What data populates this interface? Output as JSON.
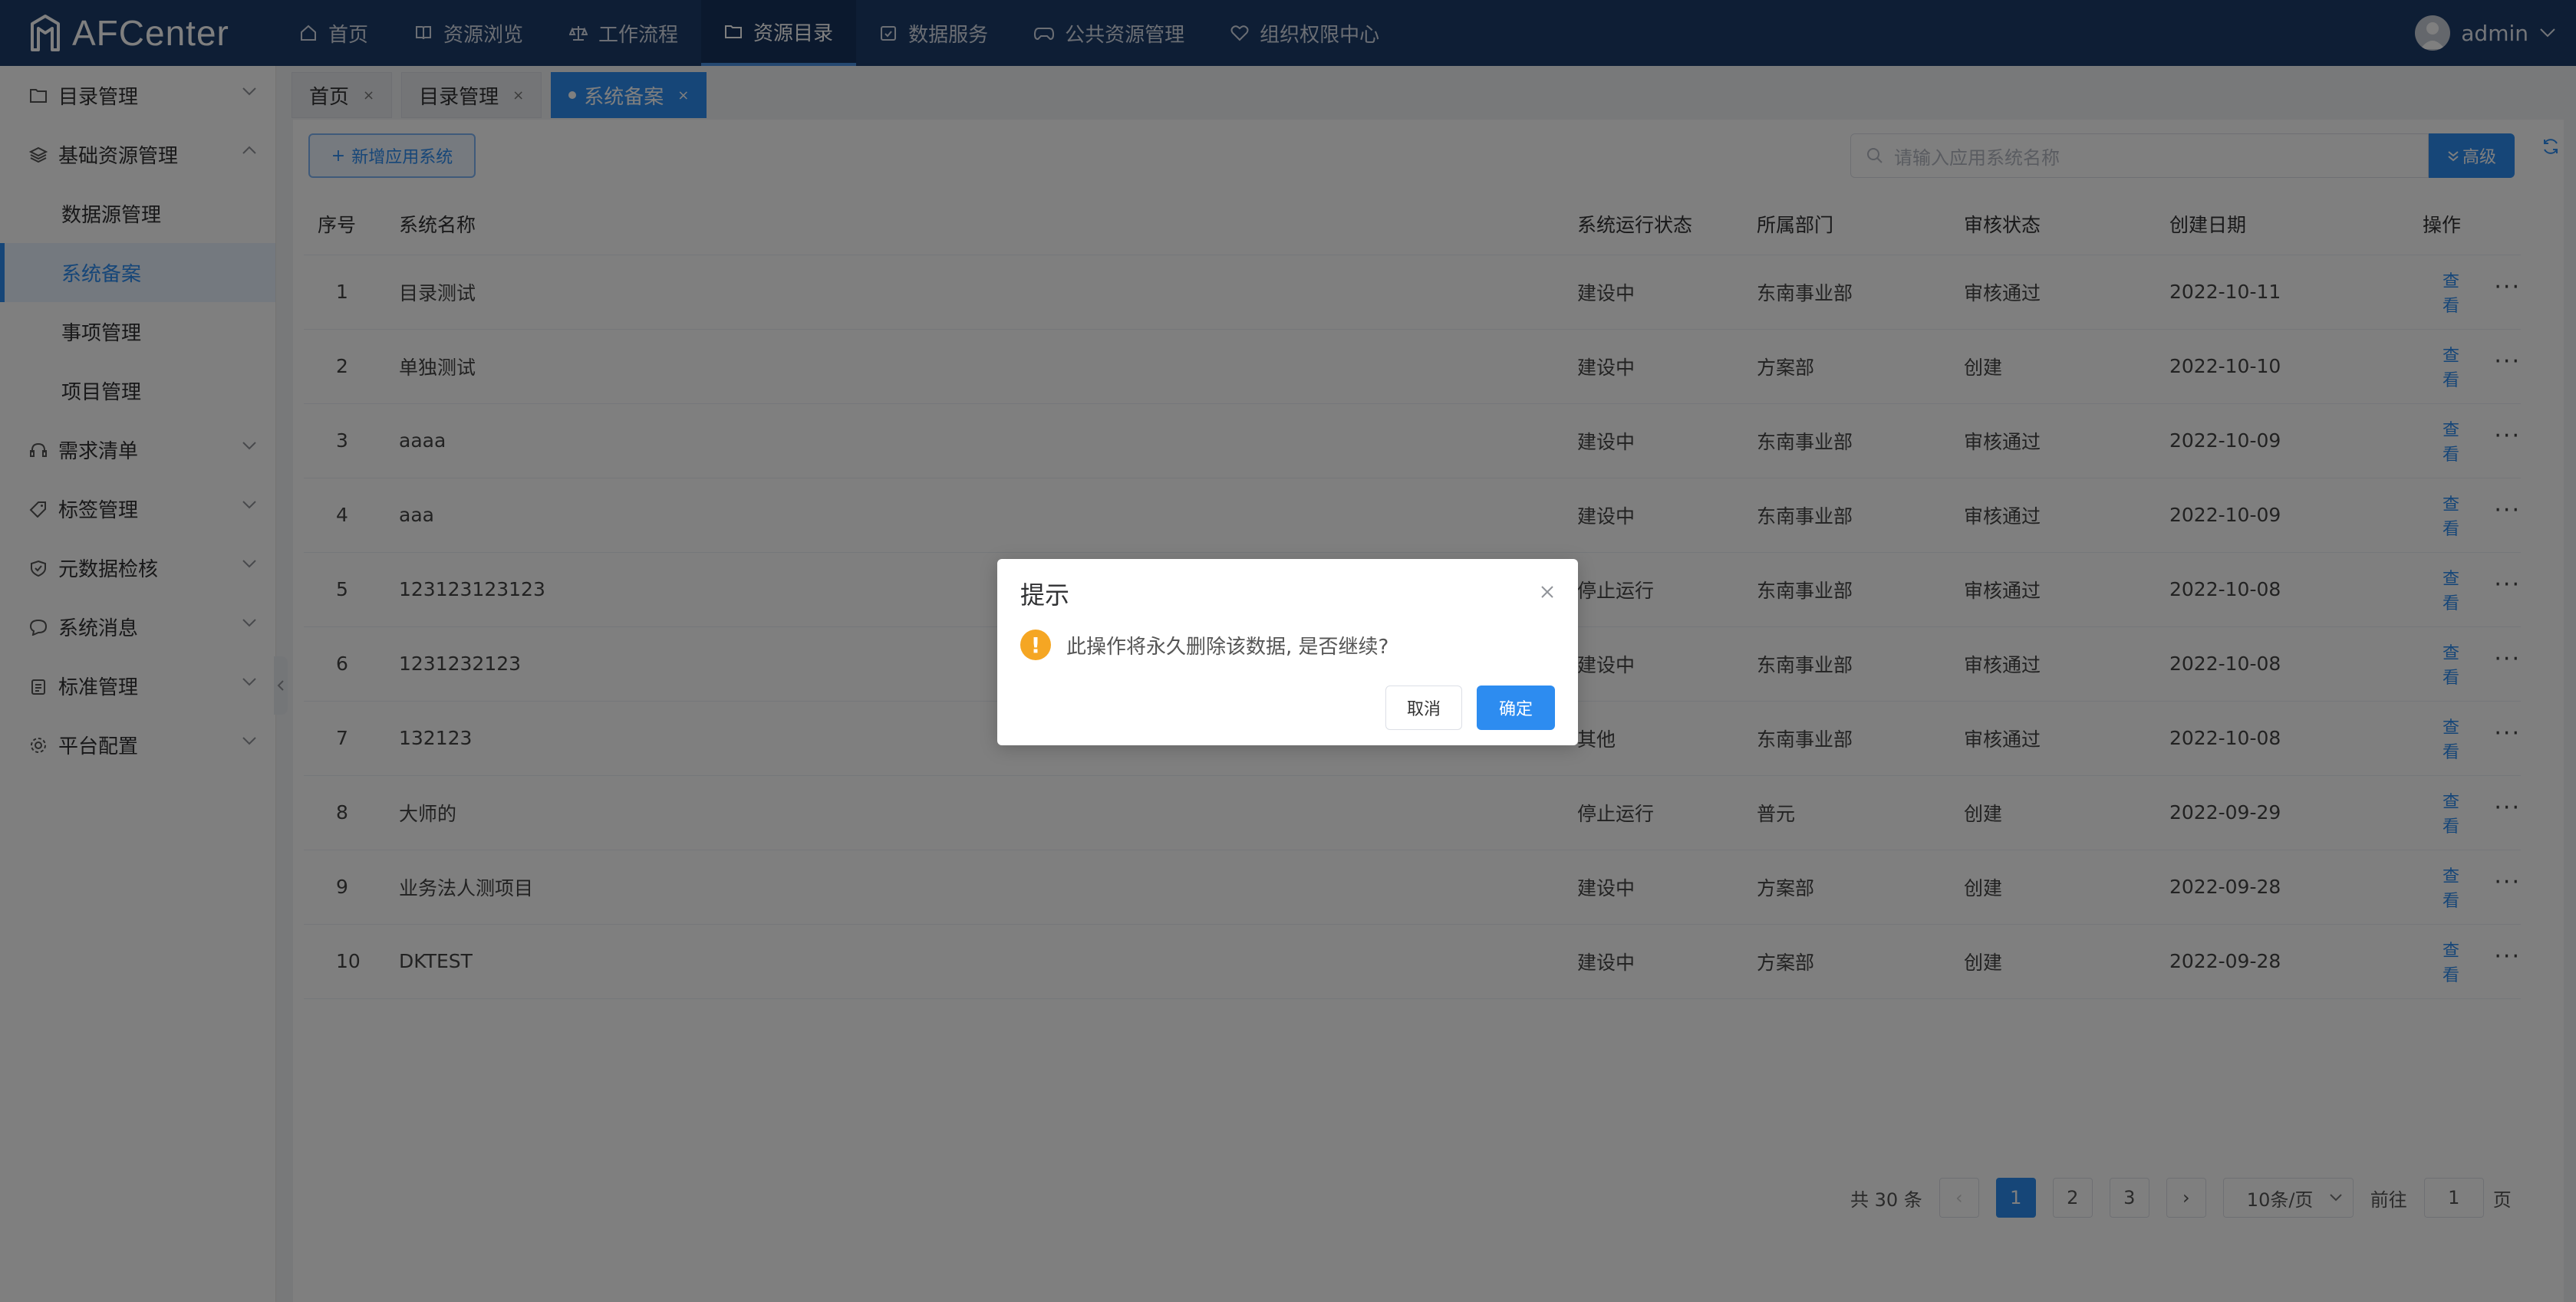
{
  "app": {
    "name": "AFCenter"
  },
  "topnav": {
    "items": [
      {
        "label": "首页",
        "icon": "home-icon"
      },
      {
        "label": "资源浏览",
        "icon": "book-icon"
      },
      {
        "label": "工作流程",
        "icon": "scale-icon"
      },
      {
        "label": "资源目录",
        "icon": "folder-icon",
        "active": true
      },
      {
        "label": "数据服务",
        "icon": "calendar-check-icon"
      },
      {
        "label": "公共资源管理",
        "icon": "gamepad-icon"
      },
      {
        "label": "组织权限中心",
        "icon": "heart-shield-icon"
      }
    ],
    "user": "admin"
  },
  "sidebar": {
    "items": [
      {
        "label": "目录管理"
      },
      {
        "label": "基础资源管理"
      },
      {
        "label": "数据源管理"
      },
      {
        "label": "系统备案"
      },
      {
        "label": "事项管理"
      },
      {
        "label": "项目管理"
      },
      {
        "label": "需求清单"
      },
      {
        "label": "标签管理"
      },
      {
        "label": "元数据检核"
      },
      {
        "label": "系统消息"
      },
      {
        "label": "标准管理"
      },
      {
        "label": "平台配置"
      }
    ]
  },
  "tabs": [
    {
      "label": "首页",
      "close": "×"
    },
    {
      "label": "目录管理",
      "close": "×"
    },
    {
      "label": "系统备案",
      "close": "×"
    }
  ],
  "toolbar": {
    "add_label": "新增应用系统",
    "search_placeholder": "请输入应用系统名称",
    "advanced_label": "高级"
  },
  "table": {
    "headers": [
      "序号",
      "系统名称",
      "系统运行状态",
      "所属部门",
      "审核状态",
      "创建日期",
      "操作"
    ],
    "view_label": "查看",
    "more_label": "···",
    "rows": [
      [
        "1",
        "目录测试",
        "建设中",
        "东南事业部",
        "审核通过",
        "2022-10-11"
      ],
      [
        "2",
        "单独测试",
        "建设中",
        "方案部",
        "创建",
        "2022-10-10"
      ],
      [
        "3",
        "aaaa",
        "建设中",
        "东南事业部",
        "审核通过",
        "2022-10-09"
      ],
      [
        "4",
        "aaa",
        "建设中",
        "东南事业部",
        "审核通过",
        "2022-10-09"
      ],
      [
        "5",
        "123123123123",
        "停止运行",
        "东南事业部",
        "审核通过",
        "2022-10-08"
      ],
      [
        "6",
        "1231232123",
        "建设中",
        "东南事业部",
        "审核通过",
        "2022-10-08"
      ],
      [
        "7",
        "132123",
        "其他",
        "东南事业部",
        "审核通过",
        "2022-10-08"
      ],
      [
        "8",
        "大师的",
        "停止运行",
        "普元",
        "创建",
        "2022-09-29"
      ],
      [
        "9",
        "业务法人测项目",
        "建设中",
        "方案部",
        "创建",
        "2022-09-28"
      ],
      [
        "10",
        "DKTEST",
        "建设中",
        "方案部",
        "创建",
        "2022-09-28"
      ]
    ]
  },
  "pagination": {
    "total": "共 30 条",
    "prev": "‹",
    "pages": [
      "1",
      "2",
      "3"
    ],
    "next": "›",
    "page_size": "10条/页",
    "goto_prefix": "前往",
    "goto_value": "1",
    "goto_suffix": "页"
  },
  "dialog": {
    "title": "提示",
    "message": "此操作将永久删除该数据, 是否继续?",
    "cancel": "取消",
    "confirm": "确定",
    "close": "×"
  },
  "colors": {
    "nav_bg": "#1d3d6b",
    "primary": "#2d8cf0",
    "warning": "#f5a623"
  }
}
